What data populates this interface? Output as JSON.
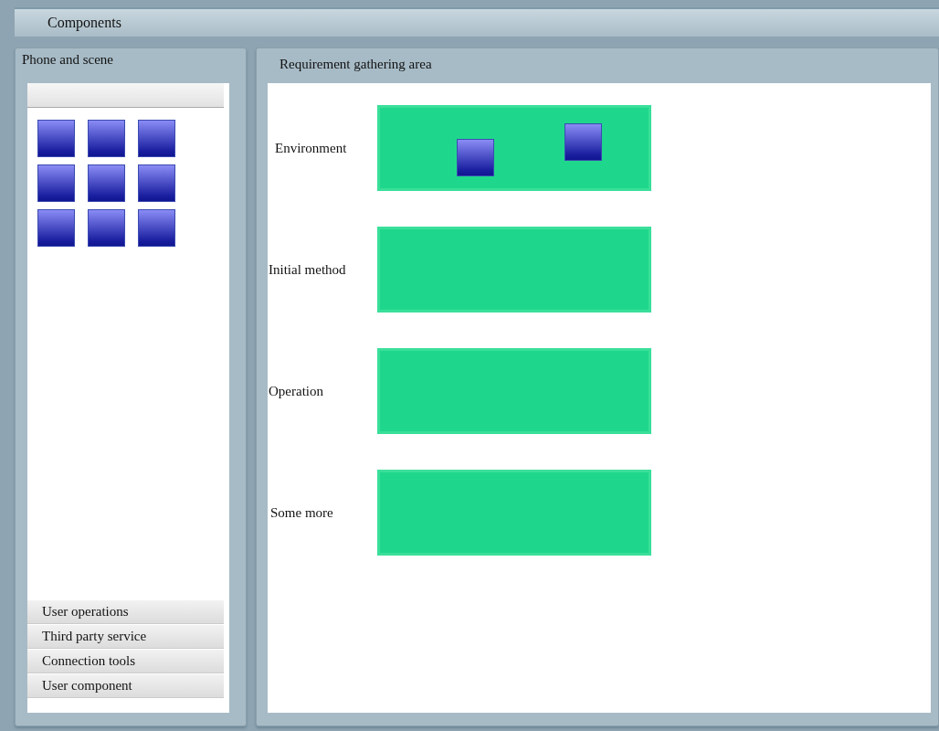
{
  "window": {
    "title": "Components"
  },
  "palette": {
    "title": "Phone and scene",
    "components": [
      {
        "kind": "tile"
      },
      {
        "kind": "tile"
      },
      {
        "kind": "tile"
      },
      {
        "kind": "tile"
      },
      {
        "kind": "tile"
      },
      {
        "kind": "tile"
      },
      {
        "kind": "tile"
      },
      {
        "kind": "tile"
      },
      {
        "kind": "tile"
      }
    ],
    "sections": [
      {
        "label": "User operations"
      },
      {
        "label": "Third party service"
      },
      {
        "label": "Connection tools"
      },
      {
        "label": "User component"
      }
    ]
  },
  "workspace": {
    "title": "Requirement gathering area",
    "rows": [
      {
        "label": "Environment",
        "components": [
          {
            "kind": "tile"
          },
          {
            "kind": "tile"
          }
        ]
      },
      {
        "label": "Initial method",
        "components": []
      },
      {
        "label": "Operation",
        "components": []
      },
      {
        "label": "Some more",
        "components": []
      }
    ]
  }
}
